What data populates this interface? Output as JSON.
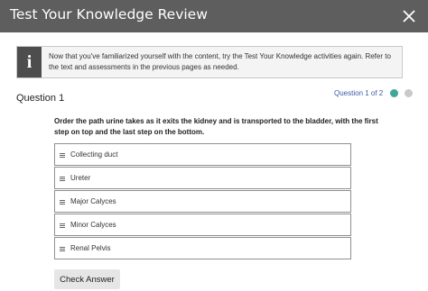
{
  "header": {
    "title": "Test Your Knowledge Review",
    "close_icon": "close-icon"
  },
  "info": {
    "icon_glyph": "i",
    "text": "Now that you've familiarized yourself with the content, try the Test Your Knowledge activities again. Refer to the text and assessments in the previous pages as needed."
  },
  "question": {
    "title": "Question 1",
    "progress": "Question 1 of 2",
    "progress_dots": [
      {
        "state": "current",
        "color": "#3fa79a"
      },
      {
        "state": "pending",
        "color": "#c9c9c9"
      }
    ],
    "prompt": "Order the path urine takes as it exits the kidney and is transported to the bladder, with the first step on top and the last step on the bottom.",
    "items": [
      {
        "label": "Collecting duct"
      },
      {
        "label": "Ureter"
      },
      {
        "label": "Major Calyces"
      },
      {
        "label": "Minor Calyces"
      },
      {
        "label": "Renal Pelvis"
      }
    ]
  },
  "actions": {
    "check_label": "Check Answer"
  }
}
